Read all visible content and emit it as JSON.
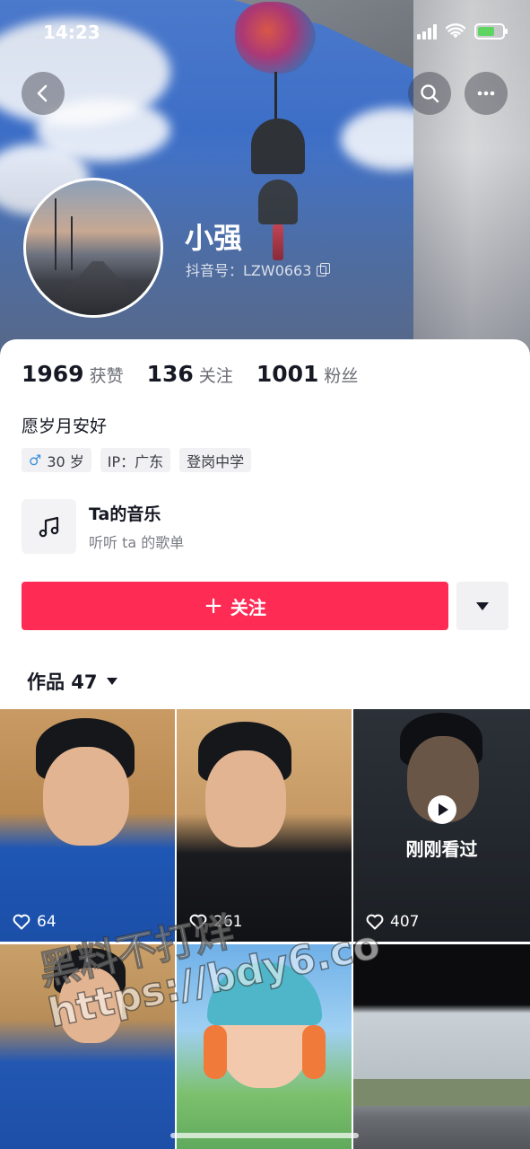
{
  "status_bar": {
    "time": "14:23"
  },
  "header": {
    "back_icon": "chevron-left-icon",
    "search_icon": "search-icon",
    "more_icon": "ellipsis-icon"
  },
  "profile": {
    "name": "小强",
    "douyin_id": "抖音号：LZW0663",
    "stats": [
      {
        "value": "1969",
        "label": "获赞"
      },
      {
        "value": "136",
        "label": "关注"
      },
      {
        "value": "1001",
        "label": "粉丝"
      }
    ],
    "bio": "愿岁月安好",
    "tags": {
      "age": "30 岁",
      "ip": "IP：广东",
      "school": "登岗中学"
    }
  },
  "music": {
    "title": "Ta的音乐",
    "subtitle": "听听 ta 的歌单"
  },
  "actions": {
    "follow_label": "关注",
    "follow_color": "#fe2c55"
  },
  "works": {
    "tab_label": "作品 47",
    "videos": [
      {
        "likes": "64"
      },
      {
        "likes": "261"
      },
      {
        "likes": "407",
        "badge": "刚刚看过"
      }
    ]
  },
  "overlay": {
    "watermark_line1": "黑料不打烊",
    "watermark_line2": "https://bdy6.co"
  }
}
